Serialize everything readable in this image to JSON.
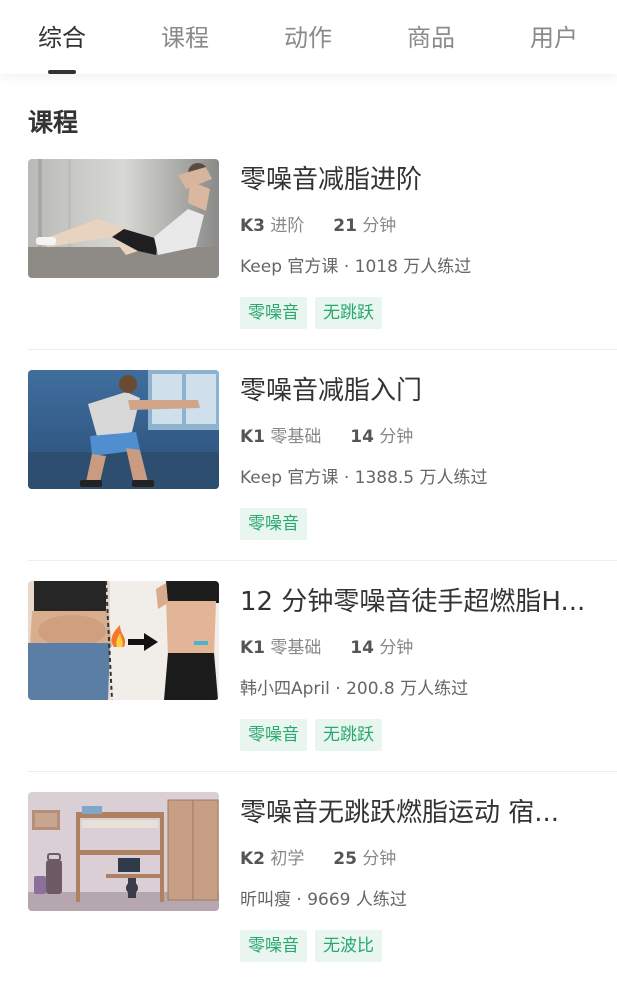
{
  "tabs": [
    {
      "label": "综合",
      "active": true
    },
    {
      "label": "课程",
      "active": false
    },
    {
      "label": "动作",
      "active": false
    },
    {
      "label": "商品",
      "active": false
    },
    {
      "label": "用户",
      "active": false
    }
  ],
  "section": {
    "title": "课程"
  },
  "courses": [
    {
      "title": "零噪音减脂进阶",
      "level": "K3",
      "level_text": "进阶",
      "duration": "21",
      "duration_unit": "分钟",
      "source": "Keep 官方课 · 1018 万人练过",
      "tags": [
        "零噪音",
        "无跳跃"
      ],
      "thumb": "sit-up-workout-photo"
    },
    {
      "title": "零噪音减脂入门",
      "level": "K1",
      "level_text": "零基础",
      "duration": "14",
      "duration_unit": "分钟",
      "source": "Keep 官方课 · 1388.5 万人练过",
      "tags": [
        "零噪音"
      ],
      "thumb": "squat-workout-photo"
    },
    {
      "title": "12 分钟零噪音徒手超燃脂H...",
      "level": "K1",
      "level_text": "零基础",
      "duration": "14",
      "duration_unit": "分钟",
      "source": "韩小四April · 200.8 万人练过",
      "tags": [
        "零噪音",
        "无跳跃"
      ],
      "thumb": "belly-fat-before-after-photo"
    },
    {
      "title": "零噪音无跳跃燃脂运动 宿...",
      "level": "K2",
      "level_text": "初学",
      "duration": "25",
      "duration_unit": "分钟",
      "source": "昕叫瘦 · 9669 人练过",
      "tags": [
        "零噪音",
        "无波比"
      ],
      "thumb": "dorm-room-illustration"
    }
  ],
  "colors": {
    "accent": "#28a86f",
    "tag_bg": "#e8f6ef",
    "text": "#333333",
    "muted": "#888888"
  }
}
